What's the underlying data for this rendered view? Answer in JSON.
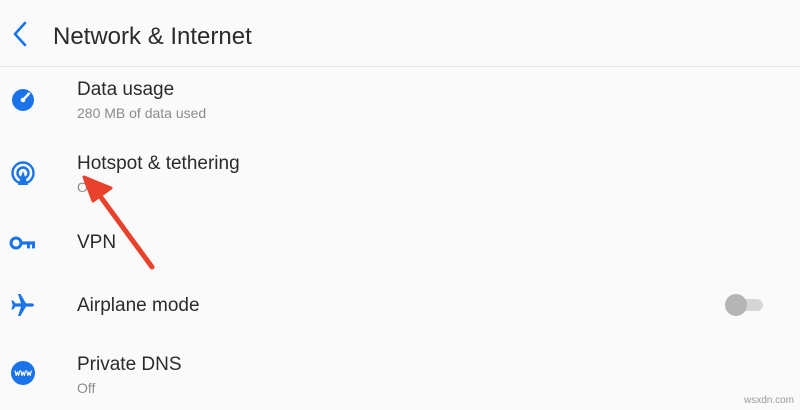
{
  "header": {
    "back_icon": "back-arrow-icon",
    "title": "Network & Internet"
  },
  "items": [
    {
      "title": "Data usage",
      "subtitle": "280 MB of data used",
      "icon": "data-usage-gauge-icon"
    },
    {
      "title": "Hotspot & tethering",
      "subtitle": "Off",
      "icon": "hotspot-icon"
    },
    {
      "title": "VPN",
      "subtitle": "",
      "icon": "vpn-key-icon"
    },
    {
      "title": "Airplane mode",
      "subtitle": "",
      "icon": "airplane-icon",
      "toggle_on": false
    },
    {
      "title": "Private DNS",
      "subtitle": "Off",
      "icon": "www-icon"
    }
  ],
  "colors": {
    "accent": "#1a73e8",
    "annotation": "#e8412c"
  },
  "watermark": "wsxdn.com"
}
